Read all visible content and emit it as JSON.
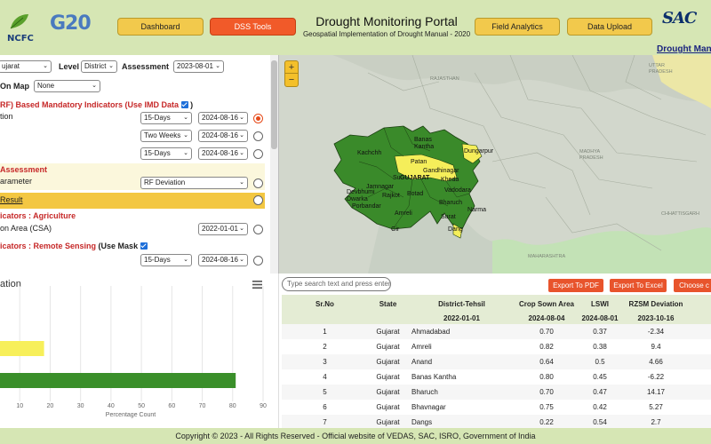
{
  "header": {
    "ncfc_logo": "NCFC",
    "g20_logo": "G20",
    "title": "Drought Monitoring Portal",
    "subtitle": "Geospatial Implementation of Drought Manual - 2020",
    "sac_logo": "SAC",
    "link": "Drought Manu",
    "nav": [
      {
        "label": "Dashboard",
        "active": false
      },
      {
        "label": "DSS Tools",
        "active": true
      },
      {
        "label": "Field Analytics",
        "active": false
      },
      {
        "label": "Data Upload",
        "active": false
      }
    ]
  },
  "controls": {
    "state_value": "ujarat",
    "level_label": "Level",
    "level_value": "District",
    "assessment_label": "Assessment",
    "assessment_value": "2023-08-01",
    "on_map_label": "On Map",
    "on_map_value": "None"
  },
  "mandatory": {
    "heading": "RF) Based Mandatory Indicators (Use IMD Data",
    "heading_end": ")",
    "row1_label": "tion",
    "rows": [
      {
        "period": "15-Days",
        "date": "2024-08-16",
        "selected": true
      },
      {
        "period": "Two Weeks",
        "date": "2024-08-16",
        "selected": false
      },
      {
        "period": "15-Days",
        "date": "2024-08-16",
        "selected": false
      }
    ]
  },
  "assessment": {
    "heading": "Assessment",
    "param_label": "arameter",
    "param_value": "RF Deviation",
    "result_label": "Result"
  },
  "agriculture": {
    "heading": "icators : Agriculture",
    "csa_label": "on Area (CSA)",
    "csa_date": "2022-01-01"
  },
  "remote": {
    "heading": "icators : Remote Sensing",
    "mask_label": "(Use Mask",
    "period": "15-Days",
    "date": "2024-08-16"
  },
  "map": {
    "zoom_in": "+",
    "zoom_out": "−",
    "labels": {
      "state": "GUJARAT",
      "kachchh": "Kachchh",
      "banas": "Banas\nKantha",
      "patan": "Patan",
      "gandhinagar": "Gandhinagar",
      "kheda": "Kheda",
      "dungarpur": "Dungarpur",
      "surendranagar": "Su",
      "devbhumi": "Devbhumi\nDwarka",
      "jamnagar": "Jamnagar",
      "rajkot": "Rajkot",
      "botad": "Botad",
      "vadodara": "Vadodara",
      "porbandar": "Porbandar",
      "amreli": "Amreli",
      "bharuch": "Bharuch",
      "narmada": "Narma",
      "surat": "Surat",
      "gir": "Gir",
      "dang": "Dang",
      "rajasthan": "RAJASTHAN",
      "madhya": "MADHYA\nPRADESH",
      "maharashtra": "MAHARASHTRA",
      "uttar": "UTTAR\nPRADESH",
      "chhattisgarh": "CHHATTISGARH"
    }
  },
  "chart": {
    "title": "ation",
    "chart_data": {
      "type": "bar",
      "orientation": "horizontal",
      "values": [
        18,
        81
      ],
      "colors": [
        "#f7ef5a",
        "#3a8f2a"
      ],
      "xlabel": "Percentage Count",
      "xlim": [
        0,
        90
      ],
      "xticks": [
        10,
        20,
        30,
        40,
        50,
        60,
        70,
        80,
        90
      ]
    }
  },
  "table": {
    "search_placeholder": "Type search text and press enter",
    "buttons": [
      "Export To PDF",
      "Export To Excel",
      "Choose c"
    ],
    "headers": [
      "Sr.No",
      "State",
      "District-Tehsil",
      "Crop Sown Area",
      "LSWI",
      "RZSM Deviation"
    ],
    "subheaders": [
      "",
      "",
      "2022-01-01",
      "2024-08-04",
      "2024-08-01",
      "2023-10-16"
    ],
    "rows": [
      [
        "1",
        "Gujarat",
        "Ahmadabad",
        "0.70",
        "0.37",
        "-2.34"
      ],
      [
        "2",
        "Gujarat",
        "Amreli",
        "0.82",
        "0.38",
        "9.4"
      ],
      [
        "3",
        "Gujarat",
        "Anand",
        "0.64",
        "0.5",
        "4.66"
      ],
      [
        "4",
        "Gujarat",
        "Banas Kantha",
        "0.80",
        "0.45",
        "-6.22"
      ],
      [
        "5",
        "Gujarat",
        "Bharuch",
        "0.70",
        "0.47",
        "14.17"
      ],
      [
        "6",
        "Gujarat",
        "Bhavnagar",
        "0.75",
        "0.42",
        "5.27"
      ],
      [
        "7",
        "Gujarat",
        "Dangs",
        "0.22",
        "0.54",
        "2.7"
      ]
    ]
  },
  "footer": "Copyright © 2023 - All Rights Reserved - Official website of VEDAS, SAC, ISRO, Government of India"
}
